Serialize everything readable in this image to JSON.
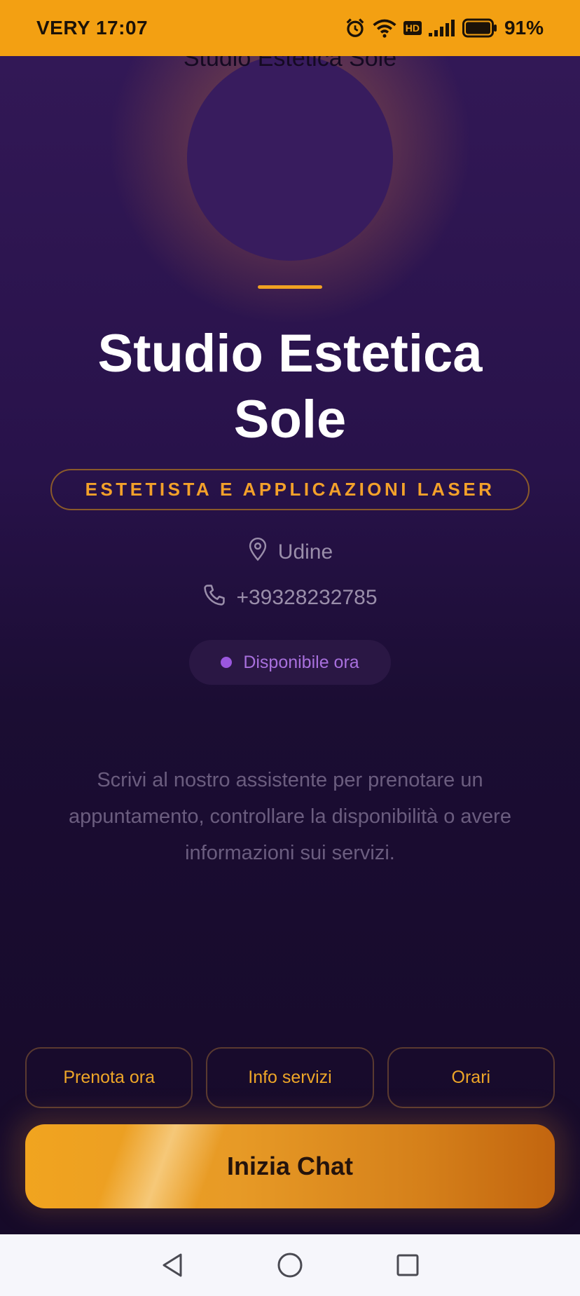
{
  "status_bar": {
    "carrier_time": "VERY 17:07",
    "hd_label": "HD",
    "battery_percent": "91%",
    "background_color": "#f3a012"
  },
  "logo": {
    "text": "Studio Estetica Sole"
  },
  "business": {
    "name": "Studio Estetica Sole",
    "category": "ESTETISTA E APPLICAZIONI LASER",
    "location": "Udine",
    "phone": "+39328232785",
    "availability": "Disponibile ora"
  },
  "description": "Scrivi al nostro assistente per prenotare un appuntamento, controllare la disponibilità o avere informazioni sui servizi.",
  "quick_actions": [
    {
      "label": "Prenota ora"
    },
    {
      "label": "Info servizi"
    },
    {
      "label": "Orari"
    }
  ],
  "cta": {
    "label": "Inizia Chat"
  },
  "nav": {
    "icons": [
      "back-icon",
      "home-icon",
      "recents-icon"
    ]
  },
  "colors": {
    "accent": "#f0a122",
    "background": "#170b2a",
    "status_dot": "#9a57de"
  }
}
